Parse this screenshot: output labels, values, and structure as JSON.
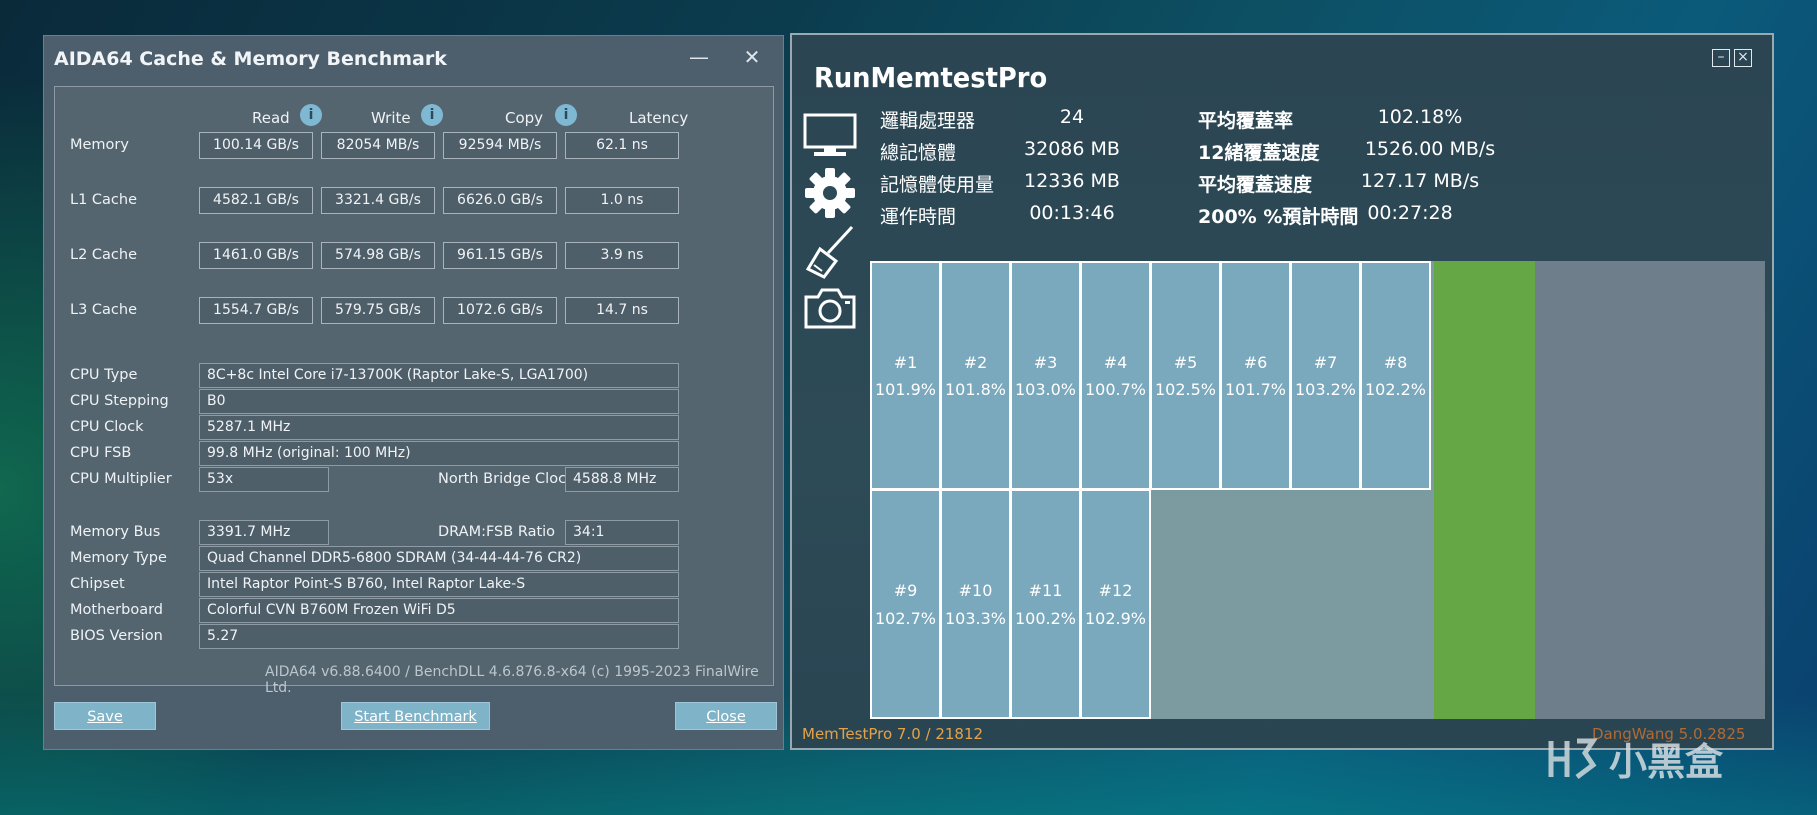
{
  "aida": {
    "title": "AIDA64 Cache & Memory Benchmark",
    "minimize": "—",
    "close": "✕",
    "columns": [
      "Read",
      "Write",
      "Copy",
      "Latency"
    ],
    "rows": [
      {
        "label": "Memory",
        "values": [
          "100.14 GB/s",
          "82054 MB/s",
          "92594 MB/s",
          "62.1 ns"
        ]
      },
      {
        "label": "L1 Cache",
        "values": [
          "4582.1 GB/s",
          "3321.4 GB/s",
          "6626.0 GB/s",
          "1.0 ns"
        ]
      },
      {
        "label": "L2 Cache",
        "values": [
          "1461.0 GB/s",
          "574.98 GB/s",
          "961.15 GB/s",
          "3.9 ns"
        ]
      },
      {
        "label": "L3 Cache",
        "values": [
          "1554.7 GB/s",
          "579.75 GB/s",
          "1072.6 GB/s",
          "14.7 ns"
        ]
      }
    ],
    "info": {
      "cpu_type_label": "CPU Type",
      "cpu_type": "8C+8c Intel Core i7-13700K  (Raptor Lake-S, LGA1700)",
      "cpu_stepping_label": "CPU Stepping",
      "cpu_stepping": "B0",
      "cpu_clock_label": "CPU Clock",
      "cpu_clock": "5287.1 MHz",
      "cpu_fsb_label": "CPU FSB",
      "cpu_fsb": "99.8 MHz  (original: 100 MHz)",
      "cpu_mult_label": "CPU Multiplier",
      "cpu_mult": "53x",
      "nb_clock_label": "North Bridge Clock",
      "nb_clock": "4588.8 MHz",
      "mem_bus_label": "Memory Bus",
      "mem_bus": "3391.7 MHz",
      "dram_ratio_label": "DRAM:FSB Ratio",
      "dram_ratio": "34:1",
      "mem_type_label": "Memory Type",
      "mem_type": "Quad Channel DDR5-6800 SDRAM  (34-44-44-76 CR2)",
      "chipset_label": "Chipset",
      "chipset": "Intel Raptor Point-S B760, Intel Raptor Lake-S",
      "mobo_label": "Motherboard",
      "mobo": "Colorful CVN B760M Frozen WiFi D5",
      "bios_label": "BIOS Version",
      "bios": "5.27"
    },
    "footer": "AIDA64 v6.88.6400 / BenchDLL 4.6.876.8-x64  (c) 1995-2023 FinalWire Ltd.",
    "buttons": {
      "save": "Save",
      "start": "Start Benchmark",
      "close": "Close"
    }
  },
  "mtp": {
    "title": "RunMemtestPro",
    "stats": {
      "logical_cpu_label": "邏輯處理器",
      "logical_cpu": "24",
      "total_mem_label": "總記憶體",
      "total_mem": "32086 MB",
      "mem_used_label": "記憶體使用量",
      "mem_used": "12336 MB",
      "run_time_label": "運作時間",
      "run_time": "00:13:46",
      "avg_cover_label": "平均覆蓋率",
      "avg_cover": "102.18%",
      "thread12_speed_label": "12緒覆蓋速度",
      "thread12_speed": "1526.00 MB/s",
      "avg_speed_label": "平均覆蓋速度",
      "avg_speed": "127.17 MB/s",
      "eta_label": "200% %預計時間",
      "eta": "00:27:28"
    },
    "threads": [
      {
        "id": "#1",
        "pct": "101.9%"
      },
      {
        "id": "#2",
        "pct": "101.8%"
      },
      {
        "id": "#3",
        "pct": "103.0%"
      },
      {
        "id": "#4",
        "pct": "100.7%"
      },
      {
        "id": "#5",
        "pct": "102.5%"
      },
      {
        "id": "#6",
        "pct": "101.7%"
      },
      {
        "id": "#7",
        "pct": "103.2%"
      },
      {
        "id": "#8",
        "pct": "102.2%"
      },
      {
        "id": "#9",
        "pct": "102.7%"
      },
      {
        "id": "#10",
        "pct": "103.3%"
      },
      {
        "id": "#11",
        "pct": "100.2%"
      },
      {
        "id": "#12",
        "pct": "102.9%"
      }
    ],
    "version": "MemTestPro 7.0 / 21812",
    "dangwang": "DangWang 5.0.2825",
    "colors": {
      "cell": "#7aa8bd",
      "green": "#64a744",
      "version": "#e3a24b"
    }
  },
  "watermark": "小黑盒"
}
